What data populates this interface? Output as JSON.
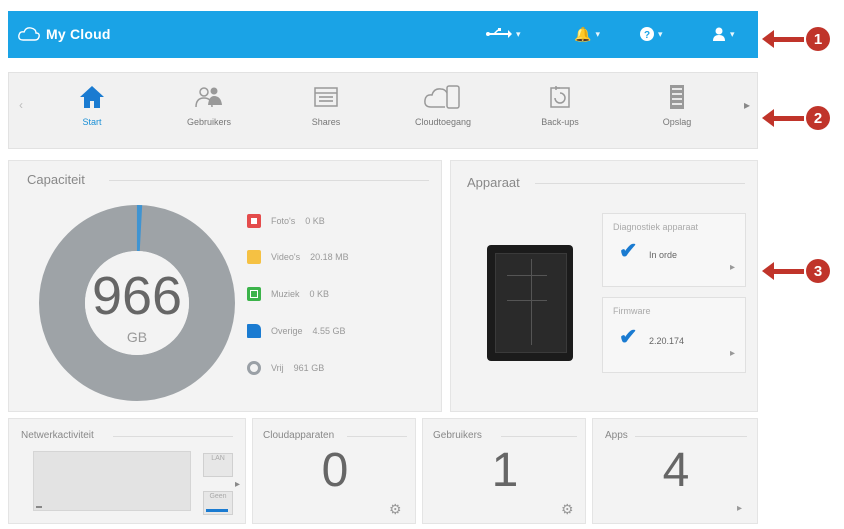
{
  "header": {
    "brand": "My Cloud",
    "usb_caret": "▾",
    "bell_caret": "▾",
    "help_caret": "▾",
    "user_caret": "▾"
  },
  "callouts": [
    "1",
    "2",
    "3"
  ],
  "nav": {
    "items": [
      {
        "label": "Start",
        "icon": "home-icon",
        "active": true
      },
      {
        "label": "Gebruikers",
        "icon": "users-icon"
      },
      {
        "label": "Shares",
        "icon": "shares-icon"
      },
      {
        "label": "Cloudtoegang",
        "icon": "cloud-access-icon"
      },
      {
        "label": "Back-ups",
        "icon": "backup-icon"
      },
      {
        "label": "Opslag",
        "icon": "storage-icon"
      }
    ]
  },
  "capacity": {
    "title": "Capaciteit",
    "value": "966",
    "unit": "GB",
    "legend": [
      {
        "label": "Foto's",
        "value": "0 KB",
        "color": "#e44c4c"
      },
      {
        "label": "Video's",
        "value": "20.18 MB",
        "color": "#f5c143"
      },
      {
        "label": "Muziek",
        "value": "0 KB",
        "color": "#3bb34a"
      },
      {
        "label": "Overige",
        "value": "4.55 GB",
        "color": "#1a7bd1"
      },
      {
        "label": "Vrij",
        "value": "961 GB",
        "color": "#9aa0a6"
      }
    ]
  },
  "device": {
    "title": "Apparaat",
    "diagnostics": {
      "title": "Diagnostiek apparaat",
      "value": "In orde"
    },
    "firmware": {
      "title": "Firmware",
      "value": "2.20.174"
    }
  },
  "tiles": {
    "network": {
      "title": "Netwerkactiviteit",
      "top": "LAN",
      "bottom": "Geen"
    },
    "cloud": {
      "title": "Cloudapparaten",
      "value": "0"
    },
    "users": {
      "title": "Gebruikers",
      "value": "1"
    },
    "apps": {
      "title": "Apps",
      "value": "4"
    }
  }
}
